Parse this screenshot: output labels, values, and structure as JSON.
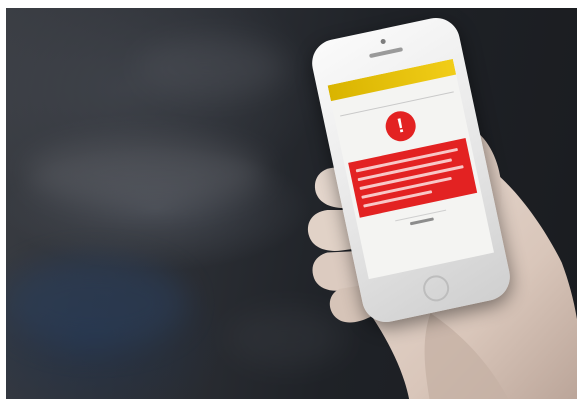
{
  "scene": {
    "subject": "hand-holding-smartphone",
    "alert_icon_glyph": "!",
    "colors": {
      "app_bar": "#f1cd18",
      "alert_red": "#e32222",
      "screen_background": "#f4f4f2",
      "phone_body": "#e6e6e6",
      "background_dark": "#1f2227"
    },
    "icons": {
      "alert": "exclamation-alert-icon"
    }
  }
}
